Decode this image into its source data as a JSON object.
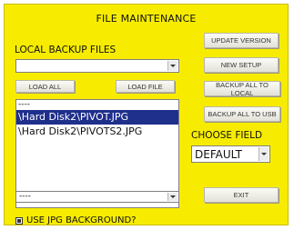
{
  "title": "FILE MAINTENANCE",
  "local_backup": {
    "label": "LOCAL BACKUP FILES",
    "dropdown_value": "",
    "load_all": "LOAD ALL",
    "load_file": "LOAD FILE",
    "list": [
      {
        "text": "----",
        "selected": false
      },
      {
        "text": "\\Hard Disk2\\PIVOT.JPG",
        "selected": true
      },
      {
        "text": "\\Hard Disk2\\PIVOTS2.JPG",
        "selected": false
      }
    ],
    "bottom_dropdown_value": "----"
  },
  "right_buttons": {
    "update_version": "UPDATE VERSION",
    "new_setup": "NEW SETUP",
    "backup_all_local": "BACKUP ALL TO LOCAL",
    "backup_all_usb": "BACKUP ALL TO USB",
    "exit": "EXIT"
  },
  "choose_field": {
    "label": "CHOOSE FIELD",
    "value": "DEFAULT"
  },
  "jpg_background": {
    "label": "USE JPG BACKGROUND?",
    "checked": true
  },
  "colors": {
    "panel": "#f7ec00",
    "selection": "#1f2f8c"
  }
}
